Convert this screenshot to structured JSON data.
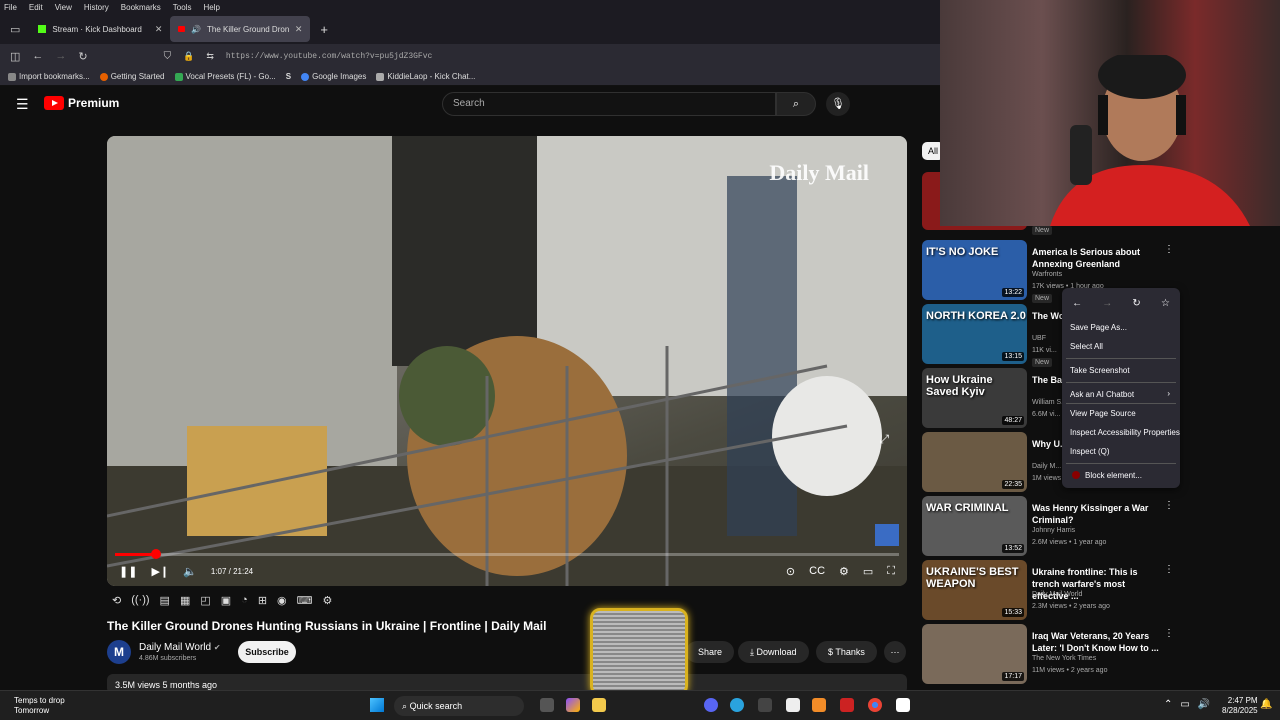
{
  "browser": {
    "menu": [
      "File",
      "Edit",
      "View",
      "History",
      "Bookmarks",
      "Tools",
      "Help"
    ],
    "tabs": [
      {
        "label": "Stream · Kick Dashboard"
      },
      {
        "label": "The Killer Ground Drones H"
      }
    ],
    "url": "https://www.youtube.com/watch?v=pu5jdZ3GFvc",
    "bookmarks": [
      "Import bookmarks...",
      "Getting Started",
      "Vocal Presets (FL) - Go...",
      "Google Images",
      "KiddieLaop - Kick Chat..."
    ]
  },
  "youtube": {
    "logo": "Premium",
    "search_placeholder": "Search",
    "video": {
      "watermark": "Daily Mail",
      "time": "1:07 / 21:24",
      "progress": 0.052,
      "title": "The Killer Ground Drones Hunting Russians in Ukraine | Frontline | Daily Mail",
      "channel": "Daily Mail World",
      "channel_initial": "M",
      "subscribers": "4.86M subscribers",
      "subscribe": "Subscribe",
      "share": "Share",
      "download": "Download",
      "thanks": "Thanks",
      "meta": "3.5M views  5 months ago"
    },
    "chip_all": "All",
    "sidebar": [
      {
        "title": "America Is Serious about Annexing Greenland",
        "channel": "Warfronts",
        "meta": "17K views • 1 hour ago",
        "badge": "New",
        "duration": "13:22",
        "thumb_text": "IT'S NO JOKE",
        "color": "#2b5ea8"
      },
      {
        "title": "The Wo... Dictato...",
        "channel": "UBF",
        "meta": "11K vi...",
        "badge": "New",
        "duration": "13:15",
        "thumb_text": "NORTH KOREA 2.0",
        "color": "#1e5f8a"
      },
      {
        "title": "The Bat... Russian...",
        "channel": "William S...",
        "meta": "6.6M vi...",
        "badge": "",
        "duration": "48:27",
        "thumb_text": "How Ukraine Saved Kyiv",
        "color": "#3a3a3a"
      },
      {
        "title": "Why U... Russian...",
        "channel": "Daily M...",
        "meta": "1M views",
        "badge": "",
        "duration": "22:35",
        "thumb_text": "",
        "color": "#6b5a44"
      },
      {
        "title": "Was Henry Kissinger a War Criminal?",
        "channel": "Johnny Harris",
        "meta": "2.6M views • 1 year ago",
        "badge": "",
        "duration": "13:52",
        "thumb_text": "WAR CRIMINAL",
        "color": "#5a5a5a"
      },
      {
        "title": "Ukraine frontline: This is trench warfare's most effective ...",
        "channel": "Daily Mail World",
        "meta": "2.3M views • 2 years ago",
        "badge": "",
        "duration": "15:33",
        "thumb_text": "UKRAINE'S BEST WEAPON",
        "color": "#6a4a2a"
      },
      {
        "title": "Iraq War Veterans, 20 Years Later: 'I Don't Know How to ...",
        "channel": "The New York Times",
        "meta": "11M views • 2 years ago",
        "badge": "",
        "duration": "17:17",
        "thumb_text": "",
        "color": "#7a6a5a"
      }
    ]
  },
  "context_menu": {
    "items": [
      "Save Page As...",
      "Select All",
      "Take Screenshot",
      "Ask an AI Chatbot",
      "View Page Source",
      "Inspect Accessibility Properties",
      "Inspect (Q)",
      "Block element..."
    ]
  },
  "taskbar": {
    "weather_line1": "Temps to drop",
    "weather_line2": "Tomorrow",
    "search": "Quick search",
    "time": "2:47 PM",
    "date": "8/28/2025"
  }
}
